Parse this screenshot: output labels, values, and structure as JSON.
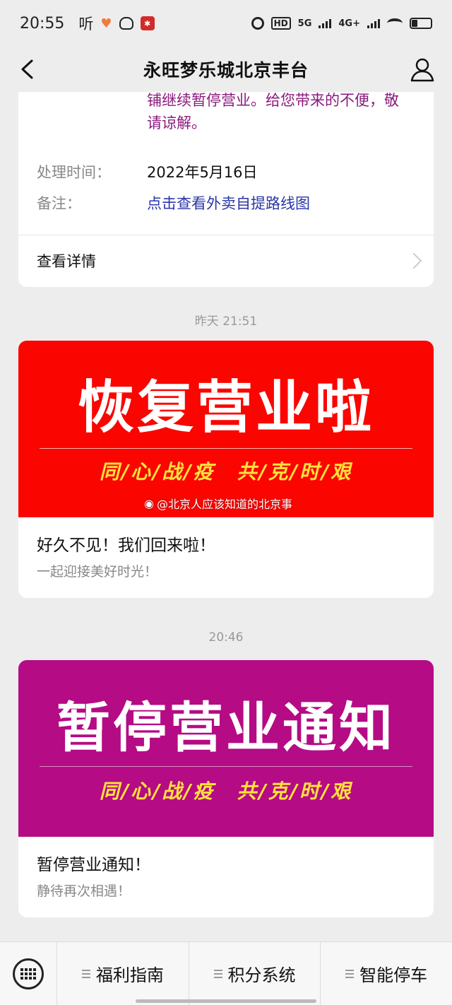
{
  "status_bar": {
    "time": "20:55",
    "listen_label": "听",
    "network_5g": "5G",
    "network_4g": "4G+",
    "hd_label": "HD",
    "icons": [
      "heart-icon",
      "cat-icon",
      "app-red-icon",
      "alarm-icon",
      "hd-icon",
      "signal-5g-icon",
      "signal-4g-icon",
      "wifi-icon",
      "battery-icon"
    ]
  },
  "nav": {
    "title": "永旺梦乐城北京丰台",
    "back_icon": "chevron-left-icon",
    "profile_icon": "user-icon"
  },
  "card1": {
    "partial_text": "铺继续暂停营业。给您带来的不便，敬请谅解。",
    "rows": [
      {
        "key": "处理时间：",
        "value": "2022年5月16日"
      },
      {
        "key": "备注：",
        "value": "点击查看外卖自提路线图"
      }
    ],
    "detail_label": "查看详情"
  },
  "timestamp1": "昨天 21:51",
  "card2": {
    "banner_title": "恢复营业啦",
    "banner_sub": "同/心/战/疫　共/克/时/艰",
    "title": "好久不见！我们回来啦！",
    "subtitle": "一起迎接美好时光！",
    "banner_color": "#fb0500"
  },
  "watermark": "@北京人应该知道的北京事",
  "timestamp2": "20:46",
  "card3": {
    "banner_title": "暂停营业通知",
    "banner_sub": "同/心/战/疫　共/克/时/艰",
    "title": "暂停营业通知！",
    "subtitle": "静待再次相遇！",
    "banner_color": "#b50b85"
  },
  "bottom_menu": {
    "keyboard_icon": "keyboard-icon",
    "items": [
      {
        "label": "福利指南"
      },
      {
        "label": "积分系统"
      },
      {
        "label": "智能停车"
      }
    ]
  }
}
